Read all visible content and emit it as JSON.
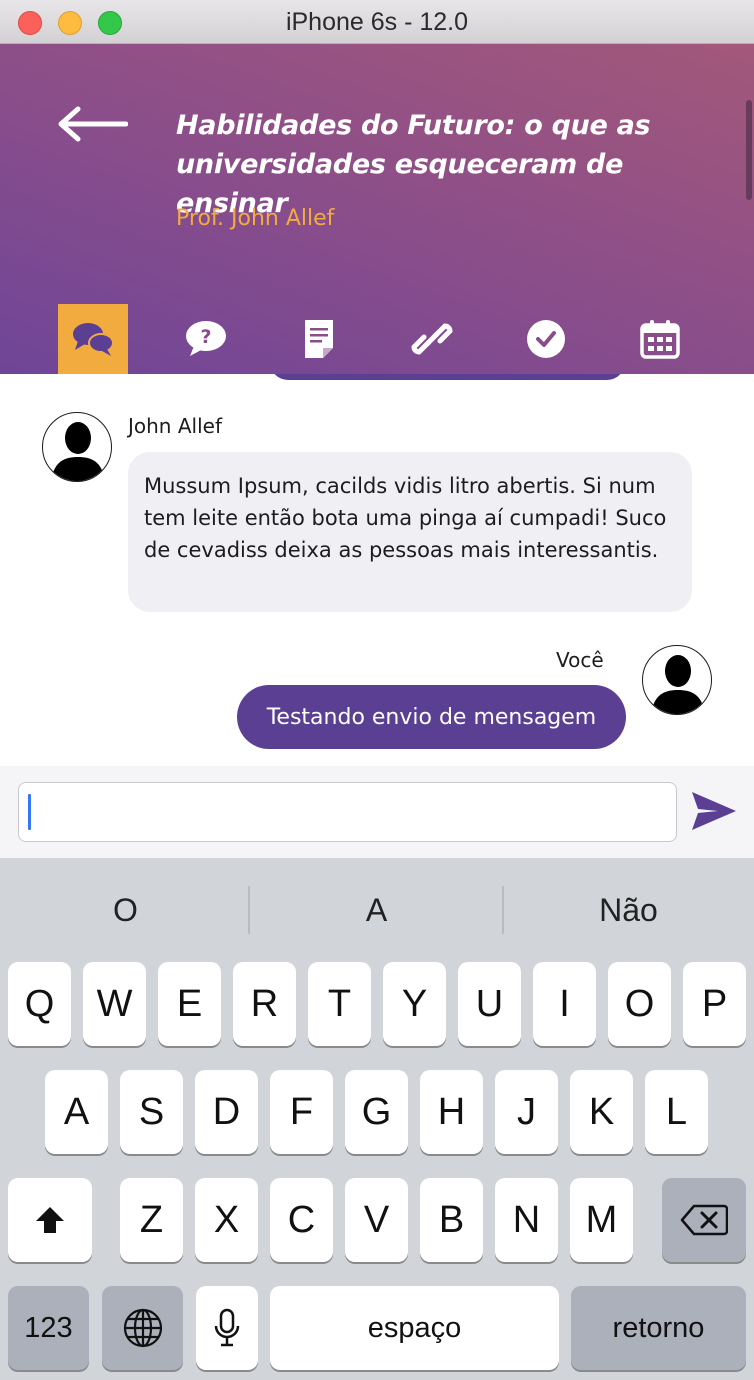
{
  "window": {
    "title": "iPhone 6s - 12.0"
  },
  "header": {
    "course_title_line1": "Habilidades do Futuro: o que as",
    "course_title_line2": "universidades esqueceram de ensinar",
    "professor": "Prof. John Allef",
    "tabs": [
      {
        "icon": "chat-bubbles-icon",
        "active": true
      },
      {
        "icon": "question-bubble-icon",
        "active": false
      },
      {
        "icon": "document-icon",
        "active": false
      },
      {
        "icon": "link-icon",
        "active": false
      },
      {
        "icon": "checkmark-circle-icon",
        "active": false
      },
      {
        "icon": "calendar-icon",
        "active": false
      }
    ]
  },
  "chat": {
    "messages": [
      {
        "sender": "John Allef",
        "direction": "incoming",
        "text": "Mussum Ipsum, cacilds vidis litro abertis. Si num tem leite então bota uma pinga aí cumpadi! Suco de cevadiss deixa as pessoas mais interessantis."
      },
      {
        "sender": "Você",
        "direction": "outgoing",
        "text": "Testando envio de mensagem"
      }
    ]
  },
  "composer": {
    "value": "",
    "placeholder": ""
  },
  "keyboard": {
    "suggestions": [
      "O",
      "A",
      "Não"
    ],
    "row1": [
      "Q",
      "W",
      "E",
      "R",
      "T",
      "Y",
      "U",
      "I",
      "O",
      "P"
    ],
    "row2": [
      "A",
      "S",
      "D",
      "F",
      "G",
      "H",
      "J",
      "K",
      "L"
    ],
    "row3": [
      "Z",
      "X",
      "C",
      "V",
      "B",
      "N",
      "M"
    ],
    "numbers_label": "123",
    "space_label": "espaço",
    "return_label": "retorno"
  },
  "colors": {
    "header_gradient_start": "#a3587a",
    "header_gradient_end": "#6f4598",
    "accent_orange": "#f2ab3f",
    "accent_purple": "#5b3f92",
    "incoming_bubble": "#efeff4"
  }
}
